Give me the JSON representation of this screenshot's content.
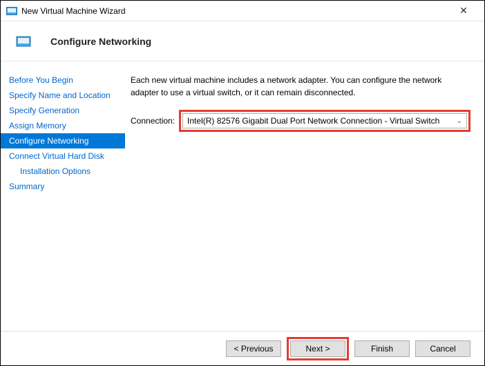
{
  "window": {
    "title": "New Virtual Machine Wizard",
    "close_glyph": "✕"
  },
  "header": {
    "title": "Configure Networking"
  },
  "sidebar": {
    "items": [
      {
        "label": "Before You Begin",
        "selected": false,
        "indent": false
      },
      {
        "label": "Specify Name and Location",
        "selected": false,
        "indent": false
      },
      {
        "label": "Specify Generation",
        "selected": false,
        "indent": false
      },
      {
        "label": "Assign Memory",
        "selected": false,
        "indent": false
      },
      {
        "label": "Configure Networking",
        "selected": true,
        "indent": false
      },
      {
        "label": "Connect Virtual Hard Disk",
        "selected": false,
        "indent": false
      },
      {
        "label": "Installation Options",
        "selected": false,
        "indent": true
      },
      {
        "label": "Summary",
        "selected": false,
        "indent": false
      }
    ]
  },
  "content": {
    "description": "Each new virtual machine includes a network adapter. You can configure the network adapter to use a virtual switch, or it can remain disconnected.",
    "connection_label": "Connection:",
    "connection_value": "Intel(R) 82576 Gigabit Dual Port Network Connection - Virtual Switch"
  },
  "footer": {
    "previous": "< Previous",
    "next": "Next >",
    "finish": "Finish",
    "cancel": "Cancel"
  }
}
